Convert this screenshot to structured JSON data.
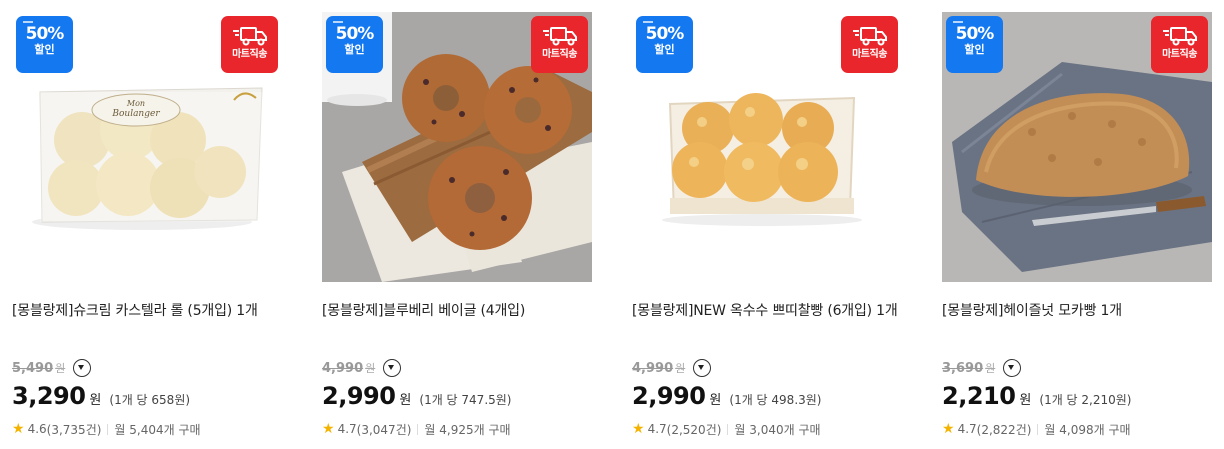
{
  "products": [
    {
      "title": "[몽블랑제]슈크림 카스텔라 롤 (5개입) 1개",
      "discount_badge": {
        "percent": "50%",
        "label": "할인"
      },
      "delivery_badge": {
        "label": "마트직송"
      },
      "original_price": "5,490",
      "original_unit": "원",
      "sale_price": "3,290",
      "sale_unit": "원",
      "unit_price": "(1개 당 658원)",
      "rating": "4.6",
      "review_count": "(3,735건)",
      "monthly_sales": "월 5,404개 구매"
    },
    {
      "title": "[몽블랑제]블루베리 베이글 (4개입)",
      "discount_badge": {
        "percent": "50%",
        "label": "할인"
      },
      "delivery_badge": {
        "label": "마트직송"
      },
      "original_price": "4,990",
      "original_unit": "원",
      "sale_price": "2,990",
      "sale_unit": "원",
      "unit_price": "(1개 당 747.5원)",
      "rating": "4.7",
      "review_count": "(3,047건)",
      "monthly_sales": "월 4,925개 구매"
    },
    {
      "title": "[몽블랑제]NEW 옥수수 쁘띠찰빵 (6개입) 1개",
      "discount_badge": {
        "percent": "50%",
        "label": "할인"
      },
      "delivery_badge": {
        "label": "마트직송"
      },
      "original_price": "4,990",
      "original_unit": "원",
      "sale_price": "2,990",
      "sale_unit": "원",
      "unit_price": "(1개 당 498.3원)",
      "rating": "4.7",
      "review_count": "(2,520건)",
      "monthly_sales": "월 3,040개 구매"
    },
    {
      "title": "[몽블랑제]헤이즐넛 모카빵 1개",
      "discount_badge": {
        "percent": "50%",
        "label": "할인"
      },
      "delivery_badge": {
        "label": "마트직송"
      },
      "original_price": "3,690",
      "original_unit": "원",
      "sale_price": "2,210",
      "sale_unit": "원",
      "unit_price": "(1개 당 2,210원)",
      "rating": "4.7",
      "review_count": "(2,822건)",
      "monthly_sales": "월 4,098개 구매"
    }
  ],
  "package_print": {
    "line1": "Mon",
    "line2": "Boulanger"
  },
  "icons": {
    "rating": "star-icon",
    "info": "chevron-down-icon",
    "delivery": "truck-icon"
  },
  "colors": {
    "discount_badge": "#1478f0",
    "delivery_badge": "#e8262b",
    "star": "#f5b301"
  }
}
